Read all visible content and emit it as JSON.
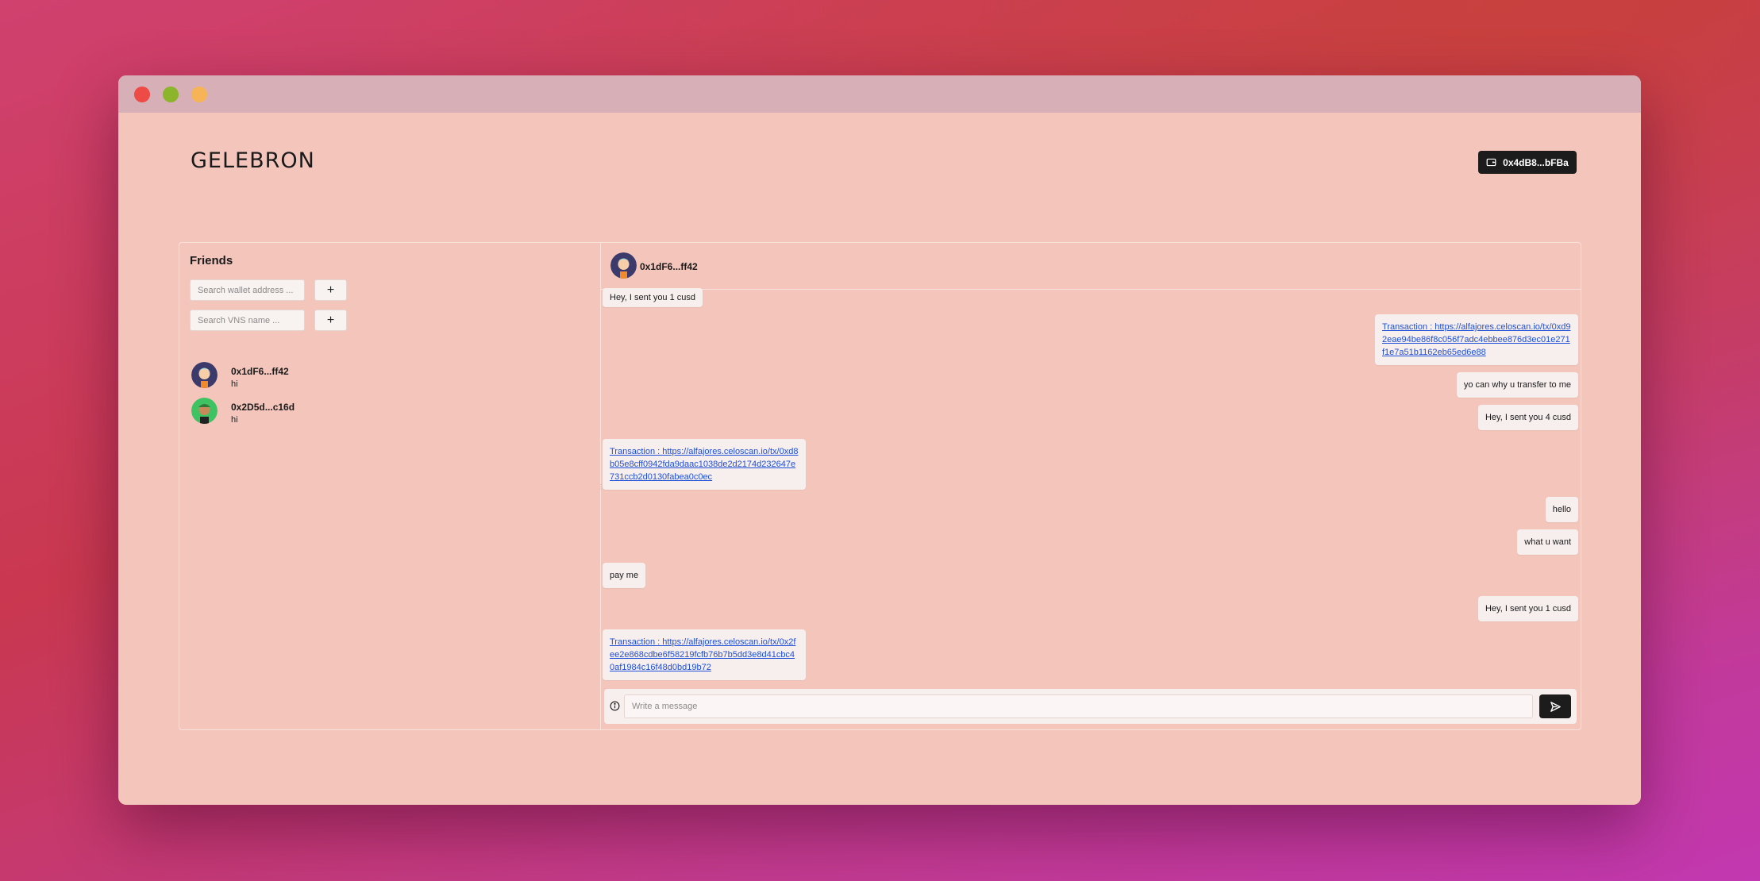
{
  "app": {
    "logo": "GELEBRON",
    "wallet_address": "0x4dB8...bFBa"
  },
  "sidebar": {
    "title": "Friends",
    "wallet_search_placeholder": "Search wallet address ...",
    "vns_search_placeholder": "Search VNS name ...",
    "add_label": "+",
    "friends": [
      {
        "name": "0x1dF6...ff42",
        "last_message": "hi",
        "avatar": "avatar-blue-hair-icon"
      },
      {
        "name": "0x2D5d...c16d",
        "last_message": "hi",
        "avatar": "avatar-green-icon"
      }
    ]
  },
  "chat": {
    "contact_name": "0x1dF6...ff42",
    "messages": [
      {
        "side": "left",
        "text": "Hey, I sent you 1  cusd"
      },
      {
        "side": "right",
        "type": "link",
        "text": "Transaction :  https://alfajores.celoscan.io/tx/0xd92eae94be86f8c056f7adc4ebbee876d3ec01e271f1e7a51b1162eb65ed6e88"
      },
      {
        "side": "right",
        "text": "yo can why u transfer to me"
      },
      {
        "side": "right",
        "text": "Hey, I sent you 4  cusd"
      },
      {
        "side": "left",
        "type": "link",
        "text": "Transaction :  https://alfajores.celoscan.io/tx/0xd8b05e8cff0942fda9daac1038de2d2174d232647e731ccb2d0130fabea0c0ec"
      },
      {
        "side": "right",
        "text": "hello"
      },
      {
        "side": "right",
        "text": "what u want"
      },
      {
        "side": "left",
        "text": "pay me"
      },
      {
        "side": "right",
        "text": "Hey, I sent you 1  cusd"
      },
      {
        "side": "left",
        "type": "link",
        "text": "Transaction :  https://alfajores.celoscan.io/tx/0x2fee2e868cdbe6f58219fcfb76b7b5dd3e8d41cbc40af1984c16f48d0bd19b72"
      }
    ],
    "composer_placeholder": "Write a message"
  },
  "colors": {
    "window_bg": "#f3c5bb",
    "titlebar": "#d7afb6",
    "dark_button": "#1c1c1c",
    "link": "#1d4fd8"
  }
}
